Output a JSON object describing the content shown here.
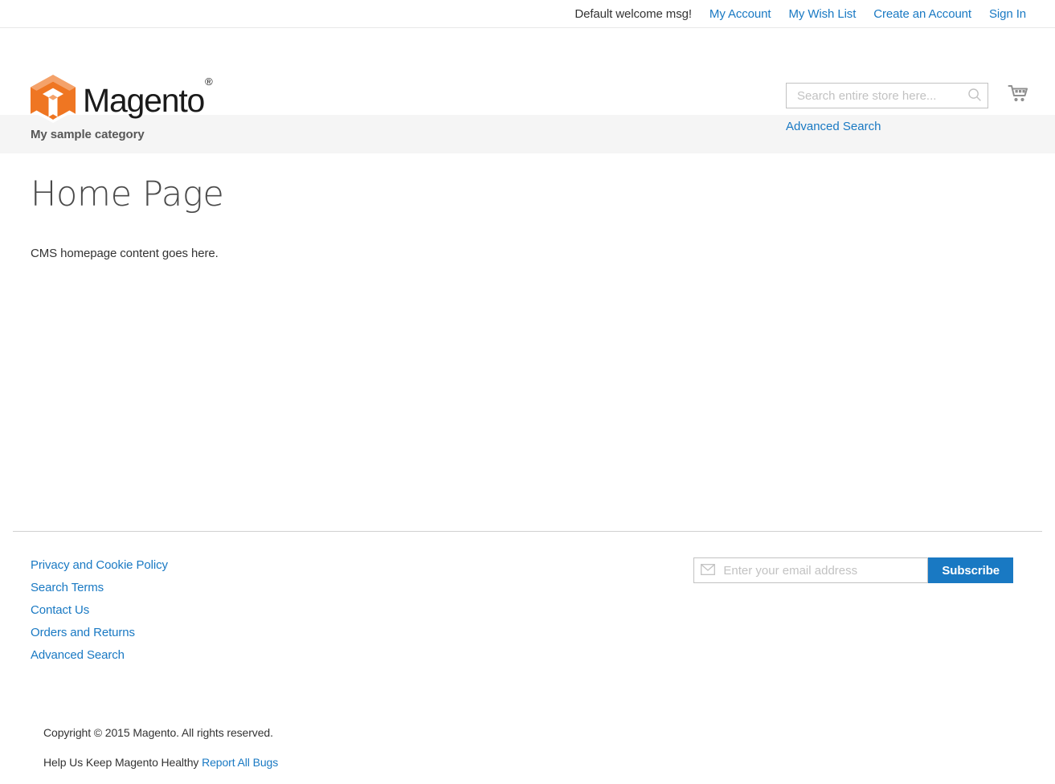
{
  "top_panel": {
    "welcome_message": "Default welcome msg!",
    "links": [
      {
        "label": "My Account"
      },
      {
        "label": "My Wish List"
      },
      {
        "label": "Create an Account"
      },
      {
        "label": "Sign In"
      }
    ]
  },
  "header": {
    "logo_text": "Magento",
    "logo_trademark": "®",
    "logo_icon": "magento-logo-icon",
    "search": {
      "placeholder": "Search entire store here...",
      "value": "",
      "button_icon": "search-icon",
      "advanced_search_label": "Advanced Search"
    },
    "cart": {
      "icon": "shopping-cart-icon"
    }
  },
  "nav": {
    "items": [
      {
        "label": "My sample category"
      }
    ]
  },
  "main": {
    "page_title": "Home Page",
    "content": "CMS homepage content goes here."
  },
  "footer": {
    "links": [
      {
        "label": "Privacy and Cookie Policy"
      },
      {
        "label": "Search Terms"
      },
      {
        "label": "Contact Us"
      },
      {
        "label": "Orders and Returns"
      },
      {
        "label": "Advanced Search"
      }
    ],
    "newsletter": {
      "placeholder": "Enter your email address",
      "value": "",
      "icon": "envelope-icon",
      "subscribe_label": "Subscribe"
    },
    "copyright": "Copyright © 2015 Magento. All rights reserved.",
    "bugs_text": "Help Us Keep Magento Healthy",
    "bugs_link_label": "Report All Bugs"
  },
  "colors": {
    "link_blue": "#1979c3",
    "logo_orange": "#f26322",
    "nav_background": "#f5f5f5"
  }
}
